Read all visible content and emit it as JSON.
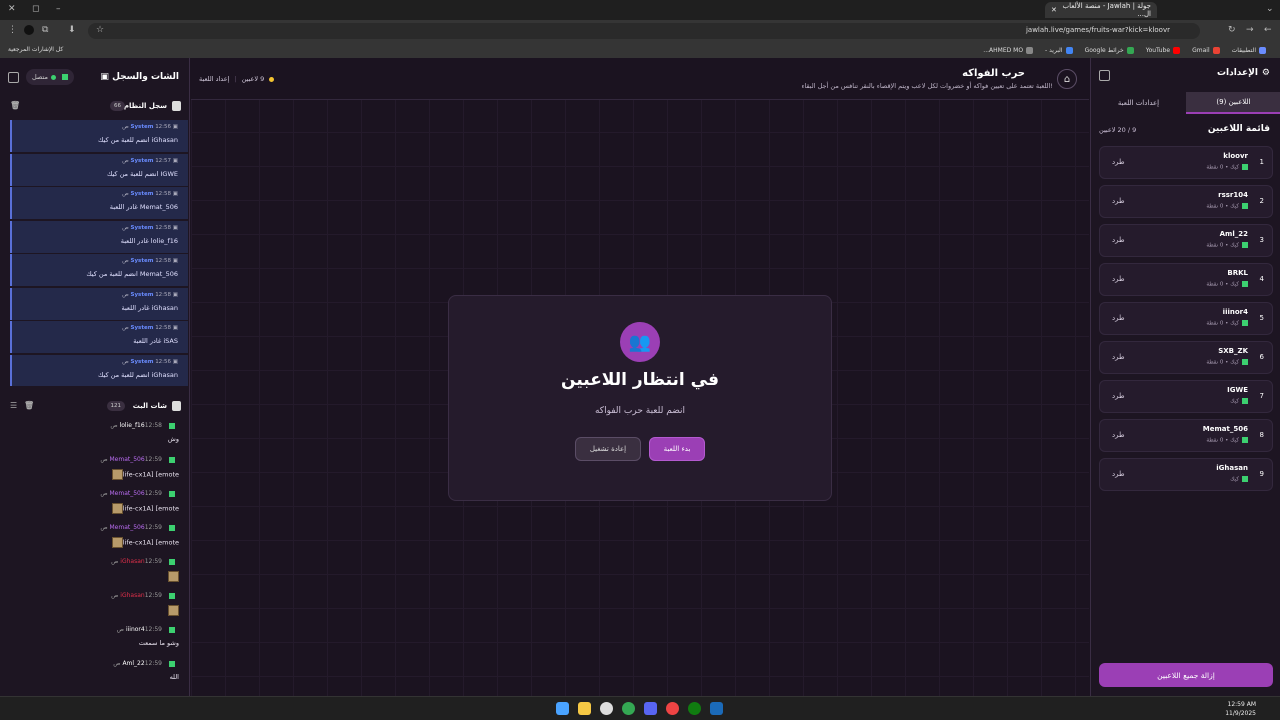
{
  "browser": {
    "tab_title": "جولة | Jawlah - منصة الألعاب ال...",
    "url": "jawlah.live/games/fruits-war?kick=kloovr",
    "bookmarks_all": "كل الإشارات المرجعية",
    "bookmarks": [
      "التطبيقات",
      "Gmail",
      "YouTube",
      "خرائط Google",
      "البريد -",
      "AHMED MO..."
    ]
  },
  "header": {
    "title": "حرب الفواكه",
    "description": "اللعبة تعتمد على تعيين فواكه أو خضروات لكل لاعب ويتم الإقصاء بالنقر تنافس من أجل البقاء!",
    "players_label": "9 لاعبين",
    "setup_label": "إعداد اللعبة"
  },
  "card": {
    "title": "في انتظار اللاعبين",
    "subtitle": "انضم للعبة حرب الفواكه",
    "start_label": "بدء اللعبة",
    "restart_label": "إعادة تشغيل"
  },
  "settings": {
    "title": "الإعدادات",
    "tabs": [
      "اللاعبين (9)",
      "إعدادات اللعبة"
    ],
    "list_title": "قائمة اللاعبين",
    "count": "9 / 20 لاعبين",
    "kick_label": "طرد",
    "kick_all": "إزالة جميع اللاعبين",
    "players": [
      {
        "n": "1",
        "name": "kloovr",
        "meta": "كيك • 0 نقطة"
      },
      {
        "n": "2",
        "name": "rssr104",
        "meta": "كيك • 0 نقطة"
      },
      {
        "n": "3",
        "name": "Aml_22",
        "meta": "كيك • 0 نقطة"
      },
      {
        "n": "4",
        "name": "BRKL",
        "meta": "كيك • 0 نقطة"
      },
      {
        "n": "5",
        "name": "iiinor4",
        "meta": "كيك • 0 نقطة"
      },
      {
        "n": "6",
        "name": "SXB_ZK",
        "meta": "كيك • 0 نقطة"
      },
      {
        "n": "7",
        "name": "IGWE",
        "meta": "كيك"
      },
      {
        "n": "8",
        "name": "Memat_506",
        "meta": "كيك • 0 نقطة"
      },
      {
        "n": "9",
        "name": "iGhasan",
        "meta": "كيك"
      }
    ]
  },
  "chatpanel": {
    "title": "الشات والسجل",
    "connected": "متصل",
    "syslog_title": "سجل النظام",
    "syslog_count": "66",
    "system_name": "System",
    "syslog": [
      {
        "time": "12:56 ص",
        "msg": "iGhasan انضم للعبة من كيك"
      },
      {
        "time": "12:57 ص",
        "msg": "IGWE انضم للعبة من كيك"
      },
      {
        "time": "12:58 ص",
        "msg": "Memat_506 غادر اللعبة"
      },
      {
        "time": "12:58 ص",
        "msg": "lolie_f16 غادر اللعبة"
      },
      {
        "time": "12:58 ص",
        "msg": "Memat_506 انضم للعبة من كيك"
      },
      {
        "time": "12:58 ص",
        "msg": "iGhasan غادر اللعبة"
      },
      {
        "time": "12:58 ص",
        "msg": "iSAS غادر اللعبة"
      },
      {
        "time": "12:56 ص",
        "msg": "iGhasan انضم للعبة من كيك"
      }
    ],
    "live_title": "شات البث",
    "live_count": "121",
    "chat": [
      {
        "user": "lolie_f16",
        "time": "12:58 ص",
        "body": "وش",
        "color": "#ffffff",
        "emote": false
      },
      {
        "user": "Memat_506",
        "time": "12:59 ص",
        "body": "life-cx1A] [emote",
        "color": "#b86cf0",
        "emote": true
      },
      {
        "user": "Memat_506",
        "time": "12:59 ص",
        "body": "life-cx1A] [emote",
        "color": "#b86cf0",
        "emote": true
      },
      {
        "user": "Memat_506",
        "time": "12:59 ص",
        "body": "life-cx1A] [emote",
        "color": "#b86cf0",
        "emote": true
      },
      {
        "user": "iGhasan",
        "time": "12:59 ص",
        "body": "",
        "color": "#e0304a",
        "emote": true
      },
      {
        "user": "iGhasan",
        "time": "12:59 ص",
        "body": "",
        "color": "#e0304a",
        "emote": true
      },
      {
        "user": "iiinor4",
        "time": "12:59 ص",
        "body": "وشو ما سمعت",
        "color": "#ffffff",
        "emote": false
      },
      {
        "user": "Aml_22",
        "time": "12:59 ص",
        "body": "الله",
        "color": "#ffffff",
        "emote": false
      }
    ]
  },
  "clock": {
    "time": "12:59 AM",
    "date": "11/9/2025"
  },
  "colors": {
    "accent": "#9b3fb5",
    "kick_badge": "#3cd070",
    "system": "#6a8cff"
  }
}
